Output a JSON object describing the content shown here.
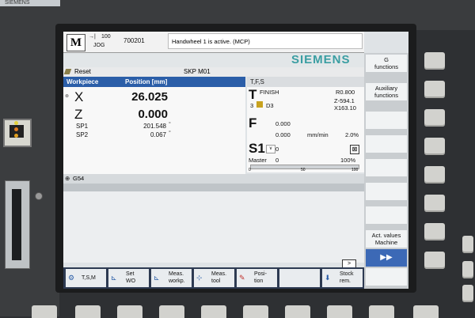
{
  "panel": {
    "brand": "SIEMENS"
  },
  "header": {
    "mode_letter": "M",
    "mode_code": "100",
    "mode_name": "JOG",
    "program_name": "700201",
    "message": "Handwheel 1 is active. (MCP)"
  },
  "brand_logo": "SIEMENS",
  "status": {
    "reset": "Reset",
    "program": "SKP M01"
  },
  "workpiece": {
    "title": "Workpiece",
    "position_label": "Position [mm]",
    "axes": [
      {
        "name": "X",
        "value": "26.025"
      },
      {
        "name": "Z",
        "value": "0.000"
      }
    ],
    "spindles": [
      {
        "name": "SP1",
        "value": "201.548",
        "unit": "°"
      },
      {
        "name": "SP2",
        "value": "0.067",
        "unit": "°"
      }
    ],
    "offset": "G54"
  },
  "tfs": {
    "title": "T,F,S",
    "tool_letter": "T",
    "tool_name": "FINISH",
    "tool_no": "3",
    "d_no": "D3",
    "radius": "R0.800",
    "z": "Z-594.1",
    "x": "X163.10",
    "feed_letter": "F",
    "feed_value": "0.000",
    "feed_value2": "0.000",
    "feed_unit": "mm/min",
    "feed_pct": "2.0%",
    "spindle_letter": "S1",
    "spindle_value": "0",
    "master_label": "Master",
    "master_value": "0",
    "spindle_pct": "100%",
    "scale_0": "0",
    "scale_50": "50",
    "scale_100": "100"
  },
  "softkeys_vertical": [
    {
      "l1": "G",
      "l2": "functions"
    },
    {
      "l1": "Auxiliary",
      "l2": "functions"
    },
    {
      "l1": "",
      "l2": ""
    },
    {
      "l1": "",
      "l2": ""
    },
    {
      "l1": "",
      "l2": ""
    },
    {
      "l1": "",
      "l2": ""
    },
    {
      "l1": "",
      "l2": ""
    },
    {
      "l1": "",
      "l2": ""
    },
    {
      "l1": "Act. values",
      "l2": "Machine"
    }
  ],
  "softkeys_vertical_arrow": "▶▶",
  "softkeys_horizontal": [
    {
      "icon": "T,S,M",
      "l1": "",
      "l2": "",
      "single": "T,S,M"
    },
    {
      "icon": "set",
      "l1": "Set",
      "l2": "WO",
      "single": ""
    },
    {
      "icon": "meas",
      "l1": "Meas.",
      "l2": "workp.",
      "single": ""
    },
    {
      "icon": "tool",
      "l1": "Meas.",
      "l2": "tool",
      "single": ""
    },
    {
      "icon": "pos",
      "l1": "Posi-",
      "l2": "tion",
      "single": ""
    },
    {
      "icon": "",
      "l1": "",
      "l2": "",
      "single": ""
    },
    {
      "icon": "stock",
      "l1": "Stock",
      "l2": "rem.",
      "single": ""
    }
  ],
  "more_arrow": ">"
}
